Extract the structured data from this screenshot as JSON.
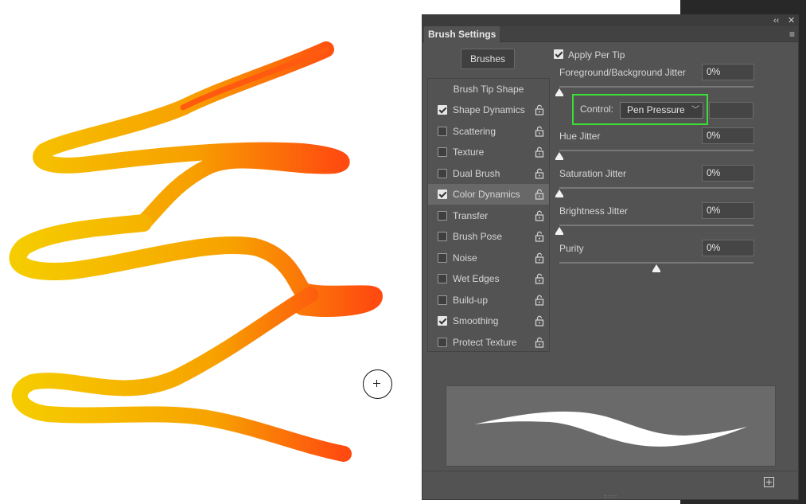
{
  "panel": {
    "title": "Brush Settings",
    "brushes_button": "Brushes",
    "collapse_icon": "double-chevron-left-icon",
    "close_icon": "close-icon",
    "menu_icon": "hamburger-menu-icon"
  },
  "sidebar": {
    "header": "Brush Tip Shape",
    "items": [
      {
        "label": "Shape Dynamics",
        "checked": true,
        "selected": false
      },
      {
        "label": "Scattering",
        "checked": false,
        "selected": false
      },
      {
        "label": "Texture",
        "checked": false,
        "selected": false
      },
      {
        "label": "Dual Brush",
        "checked": false,
        "selected": false
      },
      {
        "label": "Color Dynamics",
        "checked": true,
        "selected": true
      },
      {
        "label": "Transfer",
        "checked": false,
        "selected": false
      },
      {
        "label": "Brush Pose",
        "checked": false,
        "selected": false
      },
      {
        "label": "Noise",
        "checked": false,
        "selected": false
      },
      {
        "label": "Wet Edges",
        "checked": false,
        "selected": false
      },
      {
        "label": "Build-up",
        "checked": false,
        "selected": false
      },
      {
        "label": "Smoothing",
        "checked": true,
        "selected": false
      },
      {
        "label": "Protect Texture",
        "checked": false,
        "selected": false
      }
    ]
  },
  "settings": {
    "apply_per_tip": {
      "label": "Apply Per Tip",
      "checked": true
    },
    "fg_bg_jitter": {
      "label": "Foreground/Background Jitter",
      "value": "0%",
      "slider": 0
    },
    "control": {
      "label": "Control:",
      "value": "Pen Pressure"
    },
    "hue_jitter": {
      "label": "Hue Jitter",
      "value": "0%",
      "slider": 0
    },
    "saturation_jitter": {
      "label": "Saturation Jitter",
      "value": "0%",
      "slider": 0
    },
    "brightness_jitter": {
      "label": "Brightness Jitter",
      "value": "0%",
      "slider": 0
    },
    "purity": {
      "label": "Purity",
      "value": "0%",
      "slider": 0.5
    }
  },
  "footer": {
    "new_preset_icon": "create-new-brush-icon"
  },
  "colors": {
    "highlight": "#3bdd36",
    "stroke_start": "#ff4a10",
    "stroke_end": "#f5cc00"
  }
}
